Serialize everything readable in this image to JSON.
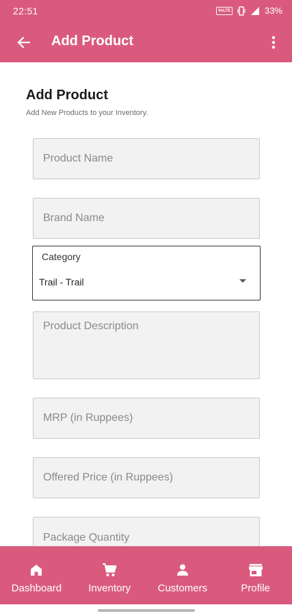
{
  "status_bar": {
    "time": "22:51",
    "volte": "VoLTE",
    "battery": "33%"
  },
  "app_bar": {
    "title": "Add Product",
    "back_icon": "arrow-back-icon",
    "menu_icon": "more-vert-icon"
  },
  "form": {
    "title": "Add Product",
    "subtitle": "Add New Products to your Inventory.",
    "fields": {
      "product_name": {
        "placeholder": "Product Name",
        "value": ""
      },
      "brand_name": {
        "placeholder": "Brand Name",
        "value": ""
      },
      "category": {
        "label": "Category",
        "value": "Trail - Trail"
      },
      "product_description": {
        "placeholder": "Product Description",
        "value": ""
      },
      "mrp": {
        "placeholder": "MRP (in Ruppees)",
        "value": ""
      },
      "offered_price": {
        "placeholder": "Offered Price (in Ruppees)",
        "value": ""
      },
      "package_quantity": {
        "placeholder": "Package Quantity",
        "value": ""
      }
    }
  },
  "bottom_nav": {
    "items": [
      {
        "label": "Dashboard",
        "icon": "home-icon"
      },
      {
        "label": "Inventory",
        "icon": "cart-icon"
      },
      {
        "label": "Customers",
        "icon": "person-icon"
      },
      {
        "label": "Profile",
        "icon": "store-icon"
      }
    ]
  },
  "colors": {
    "primary": "#da5a7e",
    "field_background": "#f2f2f2",
    "field_border": "#c8c8c8"
  }
}
